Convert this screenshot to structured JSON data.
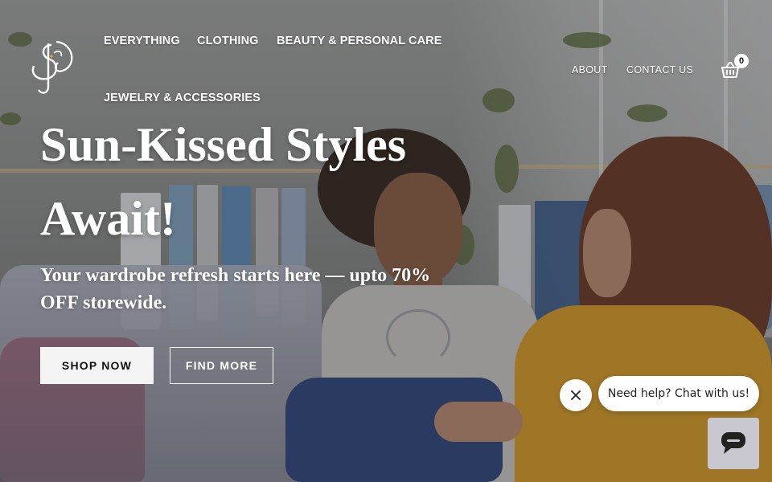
{
  "header": {
    "logo_alt": "SJ",
    "nav_primary": [
      {
        "label": "EVERYTHING"
      },
      {
        "label": "CLOTHING"
      },
      {
        "label": "BEAUTY & PERSONAL CARE"
      },
      {
        "label": "JEWELRY & ACCESSORIES"
      }
    ],
    "nav_secondary": [
      {
        "label": "ABOUT"
      },
      {
        "label": "CONTACT US"
      }
    ],
    "cart_count": "0"
  },
  "hero": {
    "headline_line1": "Sun-Kissed Styles",
    "headline_line2": "Await!",
    "subhead": "Your wardrobe refresh starts here — upto 70% OFF storewide.",
    "primary_button": "SHOP NOW",
    "secondary_button": "FIND MORE"
  },
  "chat": {
    "prompt": "Need help? Chat with us!"
  },
  "icons": {
    "logo": "sj-monogram-logo",
    "cart": "shopping-basket-icon",
    "close": "close-icon",
    "chat": "chat-bubble-icon"
  },
  "colors": {
    "text": "#ffffff",
    "primary_button_bg": "#f4f4f4",
    "chat_launcher_bg": "#c9c7cf"
  }
}
